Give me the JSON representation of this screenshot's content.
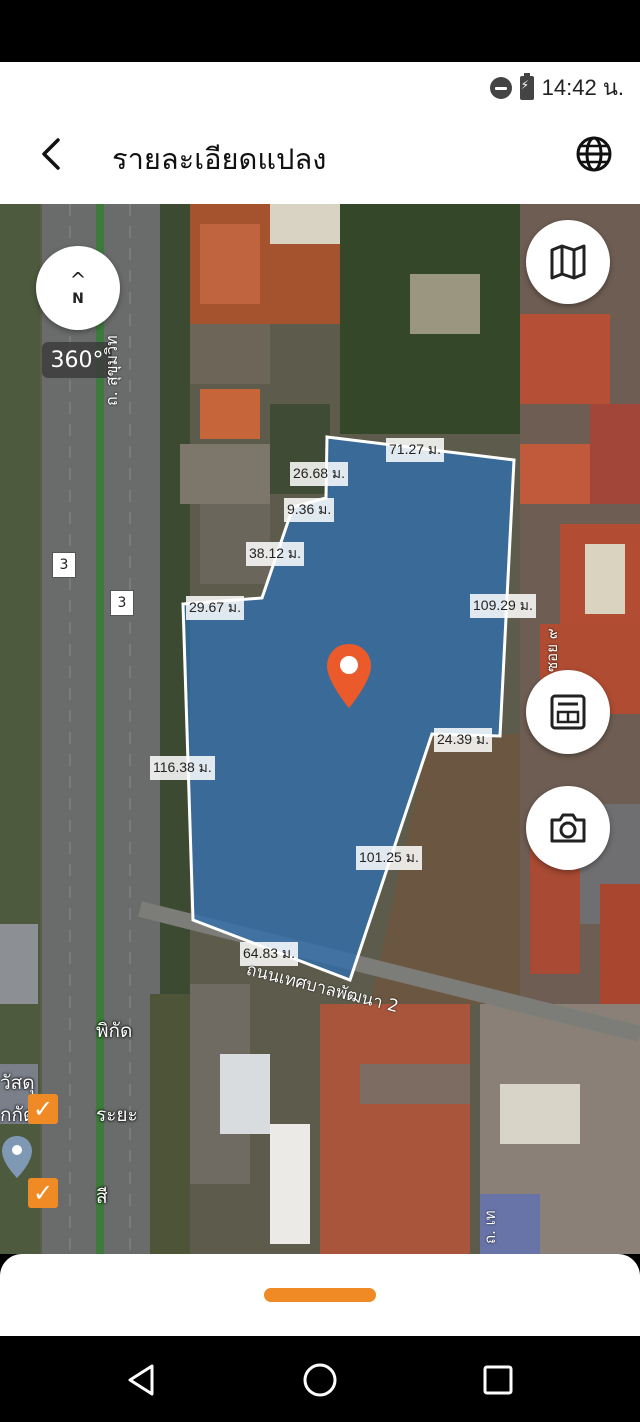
{
  "status_bar": {
    "time": "14:42 น.",
    "icons": [
      "do-not-disturb-icon",
      "battery-charging-icon"
    ]
  },
  "header": {
    "title": "รายละเอียดแปลง",
    "back_icon": "chevron-left-icon",
    "language_icon": "globe-icon"
  },
  "map": {
    "compass_letter": "N",
    "rotation": "360°",
    "road_label_main": "ถ. สุขุมวิท",
    "road_label_bottom": "ถนนเทศบาลพัฒนา 2",
    "road_label_soi": "ซอย ๙",
    "road_label_right": "ถ. เท",
    "route_shield": "3",
    "parcel_dimensions": [
      "71.27 ม.",
      "26.68 ม.",
      "9.36 ม.",
      "38.12 ม.",
      "29.67 ม.",
      "109.29 ม.",
      "24.39 ม.",
      "116.38 ม.",
      "101.25 ม.",
      "64.83 ม."
    ],
    "overlay_labels": {
      "coordinates": "พิกัด",
      "distance": "ระยะ",
      "color": "สี",
      "left_top": "วัสดุ",
      "left_bottom": "กกัด"
    },
    "accent_color": "#f08a24",
    "parcel_fill": "#2f6fb0"
  },
  "controls": [
    "compass-icon",
    "map-layers-icon",
    "parcel-info-icon",
    "camera-icon"
  ],
  "nav_bar": [
    "back-triangle-icon",
    "home-circle-icon",
    "recents-square-icon"
  ]
}
